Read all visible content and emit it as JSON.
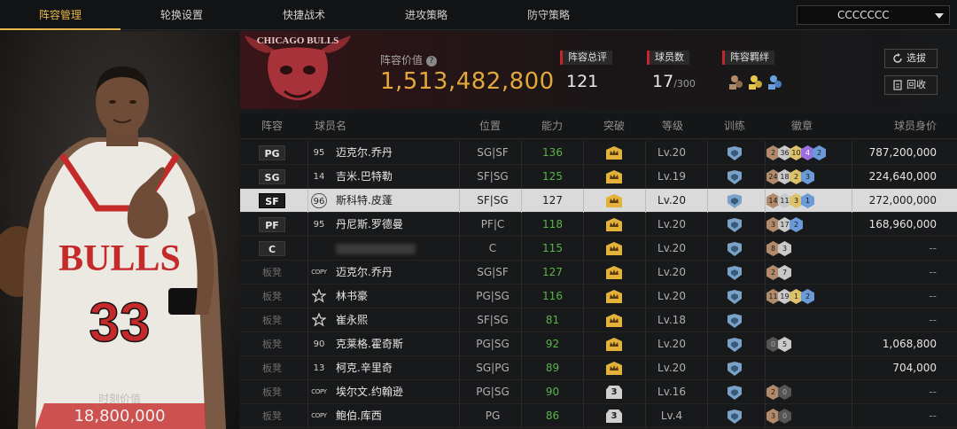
{
  "tabs": [
    "阵容管理",
    "轮换设置",
    "快捷战术",
    "进攻策略",
    "防守策略"
  ],
  "team_select": "CCCCCCC",
  "left_panel": {
    "label": "时刻价值",
    "value": "18,800,000"
  },
  "header": {
    "value_label": "阵容价值",
    "value": "1,513,482,800",
    "overall_label": "阵容总评",
    "overall_value": "121",
    "players_label": "球员数",
    "players_value": "17",
    "players_max": "/300",
    "bond_label": "阵容羁绊",
    "select_button": "选拔",
    "recycle_button": "回收",
    "logo_text": "CHICAGO BULLS"
  },
  "columns": [
    "阵容",
    "球员名",
    "位置",
    "能力",
    "突破",
    "等级",
    "训练",
    "徽章",
    "球员身价"
  ],
  "rows": [
    {
      "slot": "PG",
      "num": "95",
      "name": "迈克尔.乔丹",
      "pos": "SG|SF",
      "ability": "136",
      "level": "Lv.20",
      "badges": [
        [
          "bronze",
          "2"
        ],
        [
          "silver",
          "36"
        ],
        [
          "gold",
          "10"
        ],
        [
          "purple",
          "4"
        ],
        [
          "blue",
          "2"
        ]
      ],
      "value": "787,200,000"
    },
    {
      "slot": "SG",
      "num": "14",
      "name": "吉米.巴特勒",
      "pos": "SF|SG",
      "ability": "125",
      "level": "Lv.19",
      "badges": [
        [
          "bronze",
          "24"
        ],
        [
          "silver",
          "18"
        ],
        [
          "gold",
          "2"
        ],
        [
          "blue",
          "3"
        ]
      ],
      "value": "224,640,000"
    },
    {
      "slot": "SF",
      "num": "96",
      "name": "斯科特.皮蓬",
      "pos": "SF|SG",
      "ability": "127",
      "level": "Lv.20",
      "badges": [
        [
          "bronze",
          "14"
        ],
        [
          "silver",
          "11"
        ],
        [
          "gold",
          "3"
        ],
        [
          "blue",
          "1"
        ]
      ],
      "value": "272,000,000"
    },
    {
      "slot": "PF",
      "num": "95",
      "name": "丹尼斯.罗德曼",
      "pos": "PF|C",
      "ability": "118",
      "level": "Lv.20",
      "badges": [
        [
          "bronze",
          "3"
        ],
        [
          "silver",
          "17"
        ],
        [
          "blue",
          "2"
        ]
      ],
      "value": "168,960,000"
    },
    {
      "slot": "C",
      "num": "",
      "name": "",
      "pos": "C",
      "ability": "115",
      "level": "Lv.20",
      "badges": [
        [
          "bronze",
          "8"
        ],
        [
          "silver",
          "3"
        ]
      ],
      "value": "--"
    },
    {
      "slot": "板凳",
      "num": "COPY",
      "name": "迈克尔.乔丹",
      "pos": "SG|SF",
      "ability": "127",
      "level": "Lv.20",
      "badges": [
        [
          "bronze",
          "2"
        ],
        [
          "silver",
          "7"
        ]
      ],
      "value": "--"
    },
    {
      "slot": "板凳",
      "num": "★",
      "name": "林书豪",
      "pos": "PG|SG",
      "ability": "116",
      "level": "Lv.20",
      "badges": [
        [
          "bronze",
          "11"
        ],
        [
          "silver",
          "19"
        ],
        [
          "gold",
          "1"
        ],
        [
          "blue",
          "2"
        ]
      ],
      "value": "--"
    },
    {
      "slot": "板凳",
      "num": "★",
      "name": "崔永熙",
      "pos": "SF|SG",
      "ability": "81",
      "level": "Lv.18",
      "badges": [],
      "value": "--"
    },
    {
      "slot": "板凳",
      "num": "90",
      "name": "克莱格.霍奇斯",
      "pos": "PG|SG",
      "ability": "92",
      "level": "Lv.20",
      "badges": [
        [
          "dark",
          "0"
        ],
        [
          "silver",
          "5"
        ]
      ],
      "value": "1,068,800"
    },
    {
      "slot": "板凳",
      "num": "13",
      "name": "柯克.辛里奇",
      "pos": "SG|PG",
      "ability": "89",
      "level": "Lv.20",
      "badges": [],
      "value": "704,000"
    },
    {
      "slot": "板凳",
      "num": "COPY",
      "name": "埃尔文.约翰逊",
      "pos": "PG|SG",
      "ability": "90",
      "level": "Lv.16",
      "breakthrough": "3",
      "badges": [
        [
          "bronze",
          "2"
        ],
        [
          "dark",
          "0"
        ]
      ],
      "value": "--"
    },
    {
      "slot": "板凳",
      "num": "COPY",
      "name": "鲍伯.库西",
      "pos": "PG",
      "ability": "86",
      "level": "Lv.4",
      "breakthrough": "3",
      "badges": [
        [
          "bronze",
          "3"
        ],
        [
          "dark",
          "0"
        ]
      ],
      "value": "--"
    }
  ],
  "colors": {
    "accent": "#e8b64a",
    "selected_row": "#dadada",
    "ability_green": "#5ab44a",
    "team_red": "#c8242b"
  }
}
